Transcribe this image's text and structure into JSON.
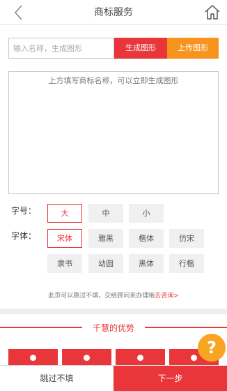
{
  "header": {
    "title": "商标服务"
  },
  "name_form": {
    "placeholder": "输入名称，生成图形",
    "generate_label": "生成图形",
    "upload_label": "上传图形"
  },
  "preview": {
    "hint": "上方填写商标名称，可以立即生成图形"
  },
  "size": {
    "label": "字号：",
    "options": [
      "大",
      "中",
      "小"
    ],
    "selected": "大"
  },
  "font": {
    "label": "字体：",
    "options": [
      "宋体",
      "雅黑",
      "楷体",
      "仿宋",
      "隶书",
      "幼圆",
      "黑体",
      "行楷"
    ],
    "selected": "宋体"
  },
  "skip_note": {
    "text": "此页可以跳过不填，交给顾问来办理哦",
    "link": "去咨询>"
  },
  "advantages": {
    "title": "千慧的优势"
  },
  "help": {
    "symbol": "?"
  },
  "footer": {
    "skip_label": "跳过不填",
    "next_label": "下一步"
  },
  "colors": {
    "accent_red": "#e8363a",
    "accent_orange": "#f7941d",
    "help_orange": "#f7a523"
  },
  "icons": {
    "back": "chevron-left-icon",
    "home": "home-icon"
  }
}
